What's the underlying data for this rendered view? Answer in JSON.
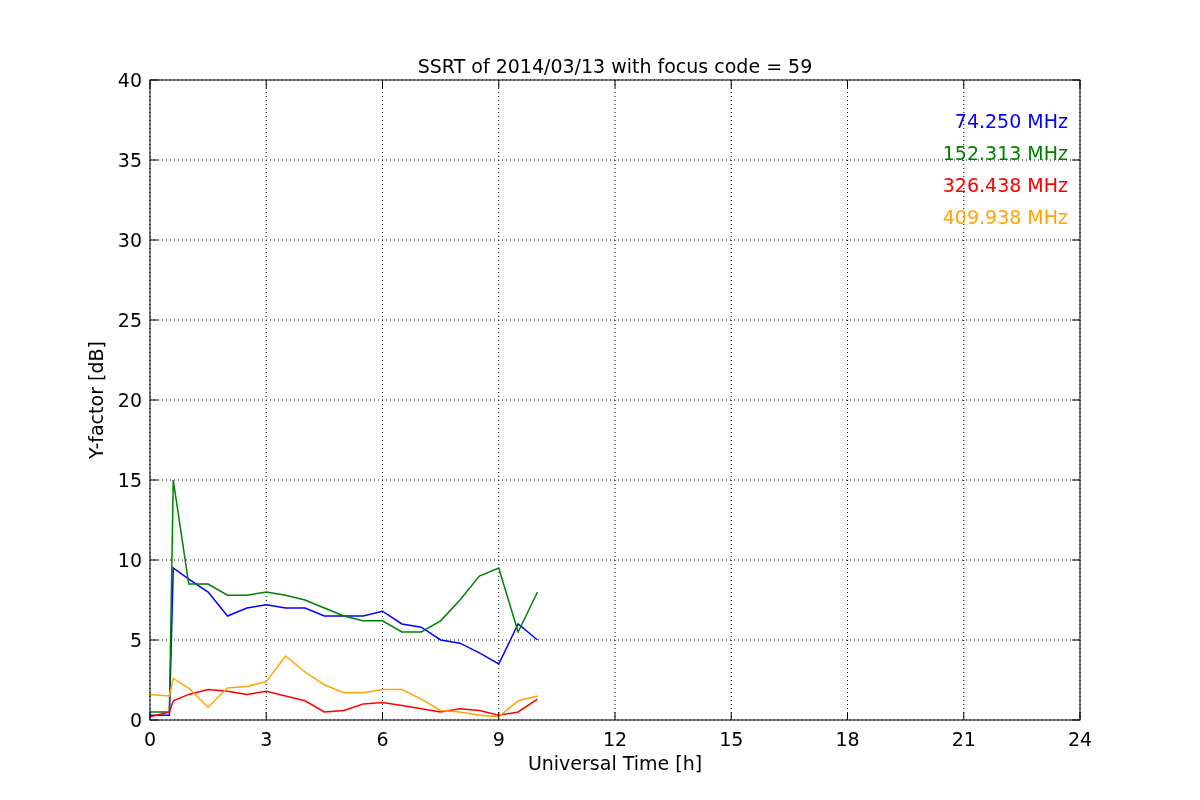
{
  "figure": {
    "chart_data": {
      "type": "line",
      "title": "SSRT of 2014/03/13 with focus code = 59",
      "xlabel": "Universal Time [h]",
      "ylabel": "Y-factor [dB]",
      "grid": true,
      "xlim": [
        0,
        24
      ],
      "ylim": [
        0,
        40
      ],
      "xticks": [
        0,
        3,
        6,
        9,
        12,
        15,
        18,
        21,
        24
      ],
      "yticks": [
        0,
        5,
        10,
        15,
        20,
        25,
        30,
        35,
        40
      ],
      "x": [
        0,
        0.5,
        0.6,
        1,
        1.5,
        2,
        2.5,
        3,
        3.5,
        4,
        4.5,
        5,
        5.5,
        6,
        6.5,
        7,
        7.5,
        8,
        8.5,
        9,
        9.5,
        10
      ],
      "series": [
        {
          "name": "74.250 MHz",
          "color": "#0000ff",
          "values": [
            0.3,
            0.3,
            9.5,
            8.8,
            8,
            6.5,
            7,
            7.2,
            7,
            7,
            6.5,
            6.5,
            6.5,
            6.8,
            6,
            5.8,
            5,
            4.8,
            4.2,
            3.5,
            6,
            5
          ]
        },
        {
          "name": "152.313 MHz",
          "color": "#008000",
          "values": [
            0.5,
            0.5,
            15,
            8.5,
            8.5,
            7.8,
            7.8,
            8,
            7.8,
            7.5,
            7,
            6.5,
            6.2,
            6.2,
            5.5,
            5.5,
            6.2,
            7.5,
            9,
            9.5,
            5.5,
            8
          ]
        },
        {
          "name": "326.438 MHz",
          "color": "#ff0000",
          "values": [
            0.2,
            0.5,
            1.2,
            1.6,
            1.9,
            1.8,
            1.6,
            1.8,
            1.5,
            1.2,
            0.5,
            0.6,
            1,
            1.1,
            0.9,
            0.7,
            0.5,
            0.7,
            0.6,
            0.3,
            0.5,
            1.3
          ]
        },
        {
          "name": "409.938 MHz",
          "color": "#ffa500",
          "values": [
            1.6,
            1.5,
            2.6,
            2,
            0.8,
            2,
            2.1,
            2.4,
            4,
            3,
            2.2,
            1.7,
            1.7,
            1.9,
            1.9,
            1.3,
            0.6,
            0.5,
            0.3,
            0.2,
            1.2,
            1.5
          ]
        }
      ]
    }
  }
}
